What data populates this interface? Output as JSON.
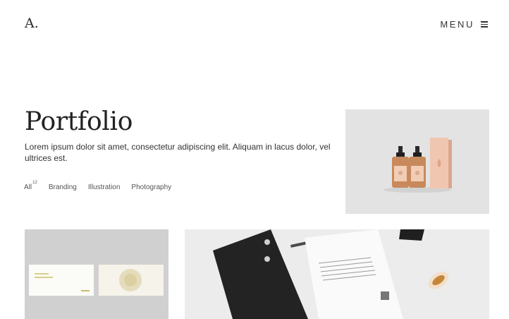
{
  "header": {
    "logo": "A.",
    "menu_label": "MENU",
    "menu_icon": "hamburger-icon"
  },
  "hero": {
    "title": "Portfolio",
    "description": "Lorem ipsum dolor sit amet, consectetur adipiscing elit. Aliquam in lacus dolor, vel ultrices est."
  },
  "filters": [
    {
      "label": "All",
      "count": "12"
    },
    {
      "label": "Branding"
    },
    {
      "label": "Illustration"
    },
    {
      "label": "Photography"
    }
  ],
  "colors": {
    "text": "#2a2a2a",
    "background": "#ffffff",
    "tile_bg": "#e4e4e4",
    "bottle_amber": "#c98a5f",
    "box_pink": "#f1c9b4"
  }
}
